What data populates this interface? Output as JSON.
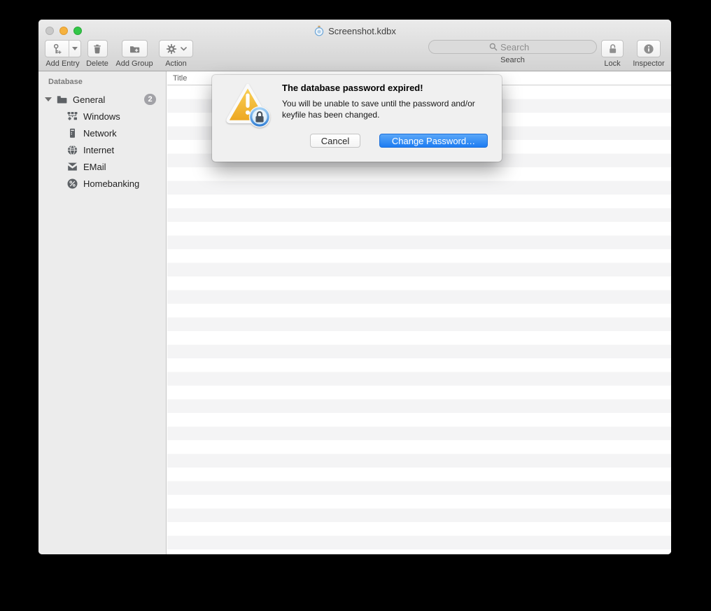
{
  "window": {
    "title": "Screenshot.kdbx",
    "title_icon": "macpass-document-icon",
    "traffic_lights": [
      {
        "name": "close",
        "state": "disabled",
        "color": "#c9c9c9"
      },
      {
        "name": "minimize",
        "color": "#f6b23e"
      },
      {
        "name": "zoom",
        "color": "#33c748"
      }
    ]
  },
  "toolbar": {
    "items": [
      {
        "label": "Add Entry",
        "icon": "key-plus-icon",
        "dropdown": true
      },
      {
        "label": "Delete",
        "icon": "trash-icon"
      },
      {
        "label": "Add Group",
        "icon": "folder-plus-icon"
      },
      {
        "label": "Action",
        "icon": "gear-icon",
        "chevron": true
      }
    ],
    "search": {
      "placeholder": "Search",
      "label": "Search",
      "icon": "magnifier-icon"
    },
    "lock": {
      "label": "Lock",
      "icon": "open-padlock-icon"
    },
    "inspector": {
      "label": "Inspector",
      "icon": "info-icon"
    }
  },
  "sidebar": {
    "header": "Database",
    "items": [
      {
        "label": "General",
        "icon": "folder-icon",
        "badge": "2",
        "expanded": true,
        "indent": 0
      },
      {
        "label": "Windows",
        "icon": "network-nodes-icon",
        "indent": 1
      },
      {
        "label": "Network",
        "icon": "server-icon",
        "indent": 1
      },
      {
        "label": "Internet",
        "icon": "globe-icon",
        "indent": 1
      },
      {
        "label": "EMail",
        "icon": "envelope-icon",
        "indent": 1
      },
      {
        "label": "Homebanking",
        "icon": "percent-icon",
        "indent": 1
      }
    ]
  },
  "entry_list": {
    "columns": [
      {
        "label": "Title"
      }
    ],
    "rows": []
  },
  "dialog": {
    "icon": "warning-triangle-lock-icon",
    "title": "The database password expired!",
    "body": "You will be unable to save until the password and/or keyfile has been changed.",
    "buttons": [
      {
        "label": "Cancel",
        "role": "cancel"
      },
      {
        "label": "Change Password…",
        "role": "default"
      }
    ]
  },
  "colors": {
    "accent_blue": "#2f86f6",
    "warning_yellow": "#f0b429",
    "stripe_gray": "#f4f4f5",
    "chrome_top": "#ebebeb",
    "chrome_bottom": "#d2d2d2",
    "sidebar_bg": "#ececec"
  }
}
